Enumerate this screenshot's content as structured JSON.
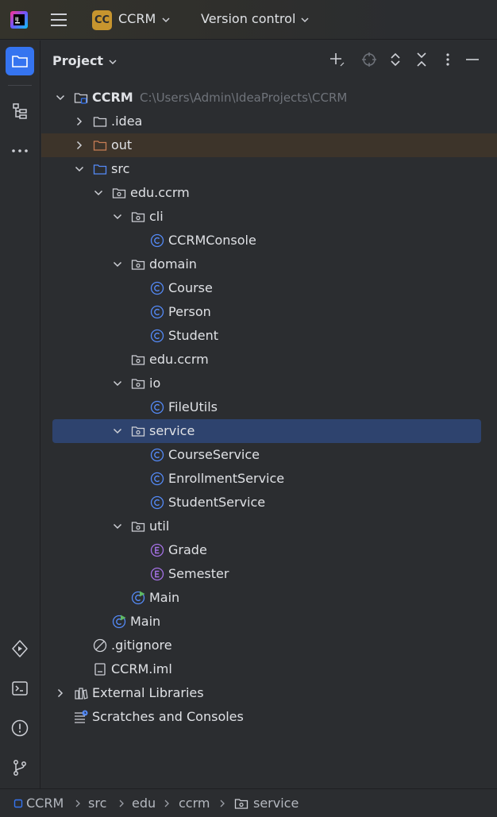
{
  "titlebar": {
    "project_badge": "CC",
    "project_name": "CCRM",
    "version_control": "Version control"
  },
  "panel": {
    "title": "Project"
  },
  "tree": [
    {
      "label": "CCRM",
      "path": "C:\\Users\\Admin\\IdeaProjects\\CCRM",
      "icon": "module-folder-icon",
      "depth": 0,
      "arrow": "down",
      "bold": true
    },
    {
      "label": ".idea",
      "icon": "folder-icon",
      "depth": 1,
      "arrow": "right"
    },
    {
      "label": "out",
      "icon": "excluded-folder-icon",
      "depth": 1,
      "arrow": "right",
      "highlight": true
    },
    {
      "label": "src",
      "icon": "source-folder-icon",
      "depth": 1,
      "arrow": "down"
    },
    {
      "label": "edu.ccrm",
      "icon": "package-icon",
      "depth": 2,
      "arrow": "down"
    },
    {
      "label": "cli",
      "icon": "package-icon",
      "depth": 3,
      "arrow": "down"
    },
    {
      "label": "CCRMConsole",
      "icon": "class-icon",
      "depth": 4
    },
    {
      "label": "domain",
      "icon": "package-icon",
      "depth": 3,
      "arrow": "down"
    },
    {
      "label": "Course",
      "icon": "class-icon",
      "depth": 4
    },
    {
      "label": "Person",
      "icon": "class-icon",
      "depth": 4
    },
    {
      "label": "Student",
      "icon": "class-icon",
      "depth": 4
    },
    {
      "label": "edu.ccrm",
      "icon": "package-icon",
      "depth": 3
    },
    {
      "label": "io",
      "icon": "package-icon",
      "depth": 3,
      "arrow": "down"
    },
    {
      "label": "FileUtils",
      "icon": "class-icon",
      "depth": 4
    },
    {
      "label": "service",
      "icon": "package-icon",
      "depth": 3,
      "arrow": "down",
      "selected": true
    },
    {
      "label": "CourseService",
      "icon": "class-icon",
      "depth": 4
    },
    {
      "label": "EnrollmentService",
      "icon": "class-icon",
      "depth": 4
    },
    {
      "label": "StudentService",
      "icon": "class-icon",
      "depth": 4
    },
    {
      "label": "util",
      "icon": "package-icon",
      "depth": 3,
      "arrow": "down"
    },
    {
      "label": "Grade",
      "icon": "enum-icon",
      "depth": 4
    },
    {
      "label": "Semester",
      "icon": "enum-icon",
      "depth": 4
    },
    {
      "label": "Main",
      "icon": "main-class-icon",
      "depth": 3
    },
    {
      "label": "Main",
      "icon": "main-class-icon",
      "depth": 2
    },
    {
      "label": ".gitignore",
      "icon": "ignored-file-icon",
      "depth": 1
    },
    {
      "label": "CCRM.iml",
      "icon": "iml-file-icon",
      "depth": 1
    },
    {
      "label": "External Libraries",
      "icon": "libraries-icon",
      "depth": 0,
      "arrow": "right"
    },
    {
      "label": "Scratches and Consoles",
      "icon": "scratches-icon",
      "depth": 0
    }
  ],
  "breadcrumb": [
    "CCRM",
    "src",
    "edu",
    "ccrm",
    "service"
  ],
  "colors": {
    "accent": "#3574f0",
    "selection": "#2e436e",
    "excluded_row": "#3d342a",
    "class_icon": "#548af7",
    "enum_icon": "#a571e6",
    "excluded_folder": "#c77d55"
  }
}
